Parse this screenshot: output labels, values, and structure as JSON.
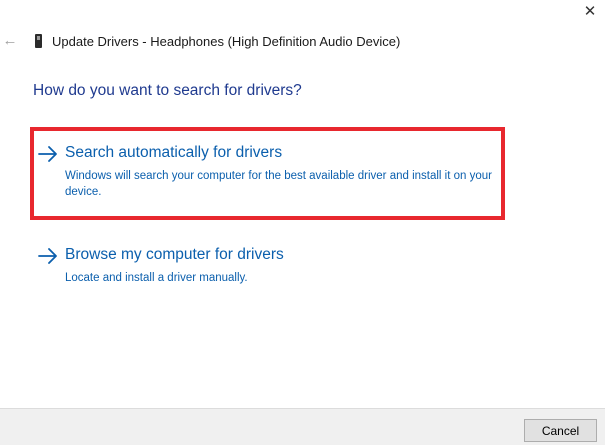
{
  "window": {
    "title": "Update Drivers - Headphones (High Definition Audio Device)",
    "close_glyph": "✕",
    "back_glyph": "←"
  },
  "main": {
    "question": "How do you want to search for drivers?",
    "options": [
      {
        "title": "Search automatically for drivers",
        "description": "Windows will search your computer for the best available driver and install it on your device.",
        "highlighted": true,
        "highlight_color": "#e8282e"
      },
      {
        "title": "Browse my computer for drivers",
        "description": "Locate and install a driver manually.",
        "highlighted": false
      }
    ]
  },
  "footer": {
    "cancel_label": "Cancel"
  },
  "colors": {
    "link_blue": "#0b5fad",
    "heading_blue": "#1f3a8f",
    "highlight_red": "#e8282e"
  }
}
